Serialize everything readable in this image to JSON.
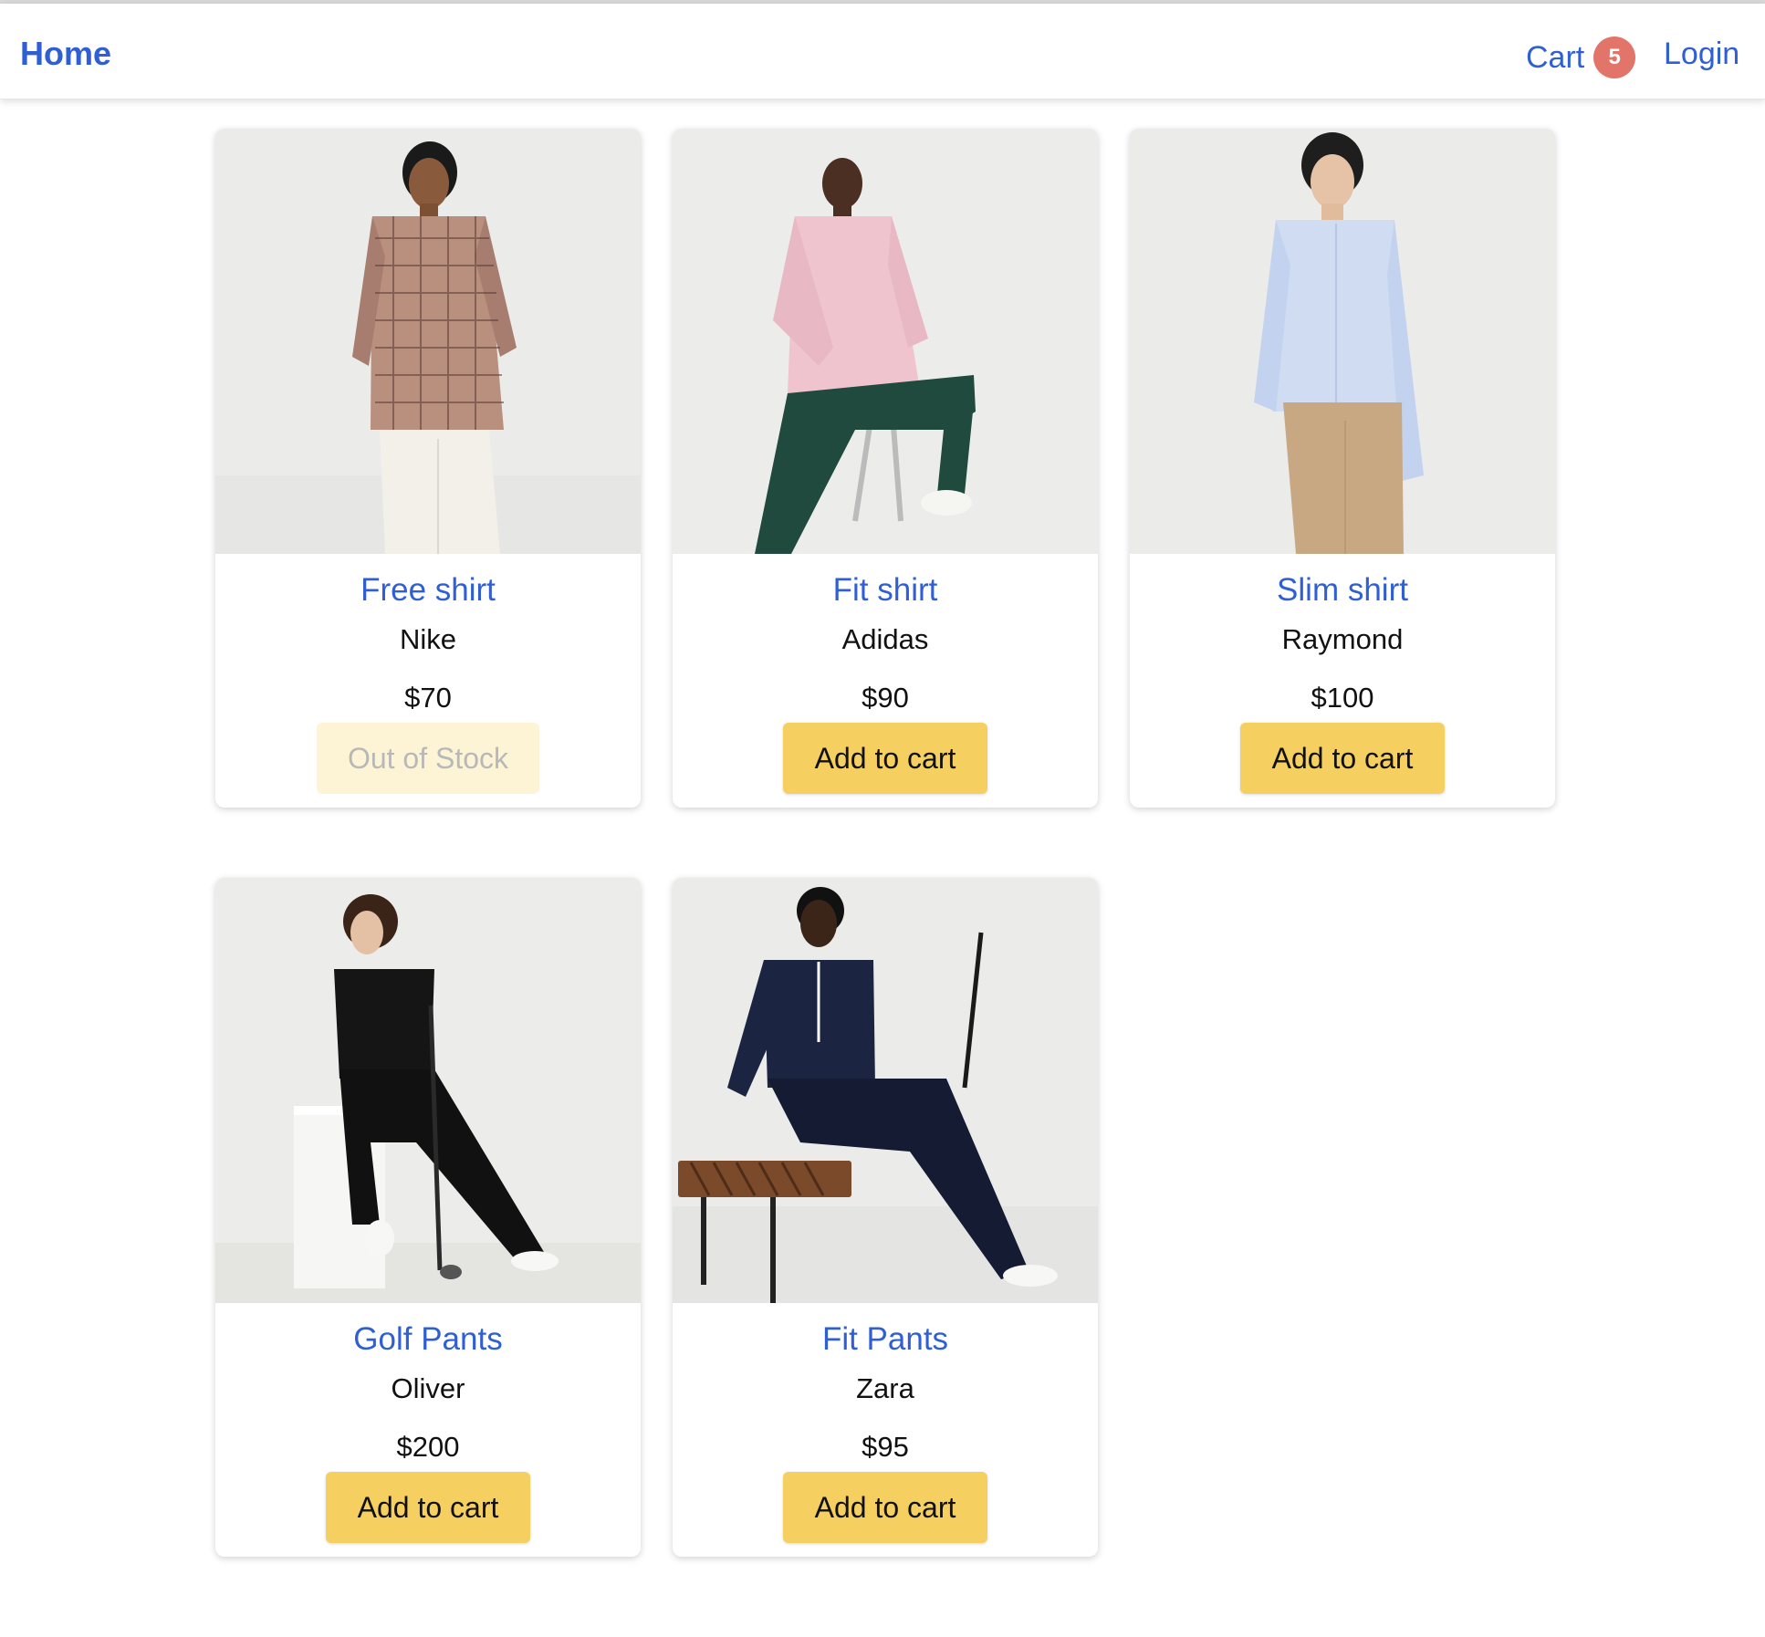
{
  "header": {
    "brand": "Home",
    "cart_label": "Cart",
    "cart_count": "5",
    "login_label": "Login"
  },
  "products": [
    {
      "name": "Free shirt",
      "brand": "Nike",
      "price": "$70",
      "button": "Out of Stock",
      "in_stock": false,
      "image_icon": "model-checked-shirt-photo"
    },
    {
      "name": "Fit shirt",
      "brand": "Adidas",
      "price": "$90",
      "button": "Add to cart",
      "in_stock": true,
      "image_icon": "model-pink-shirt-photo"
    },
    {
      "name": "Slim shirt",
      "brand": "Raymond",
      "price": "$100",
      "button": "Add to cart",
      "in_stock": true,
      "image_icon": "model-light-blue-shirt-photo"
    },
    {
      "name": "Golf Pants",
      "brand": "Oliver",
      "price": "$200",
      "button": "Add to cart",
      "in_stock": true,
      "image_icon": "model-black-golf-pants-photo"
    },
    {
      "name": "Fit Pants",
      "brand": "Zara",
      "price": "$95",
      "button": "Add to cart",
      "in_stock": true,
      "image_icon": "model-navy-pants-photo"
    }
  ],
  "colors": {
    "link": "#2f5fd3",
    "button": "#f5d061",
    "button_disabled": "#fdf4d6",
    "badge": "#e2746a"
  }
}
